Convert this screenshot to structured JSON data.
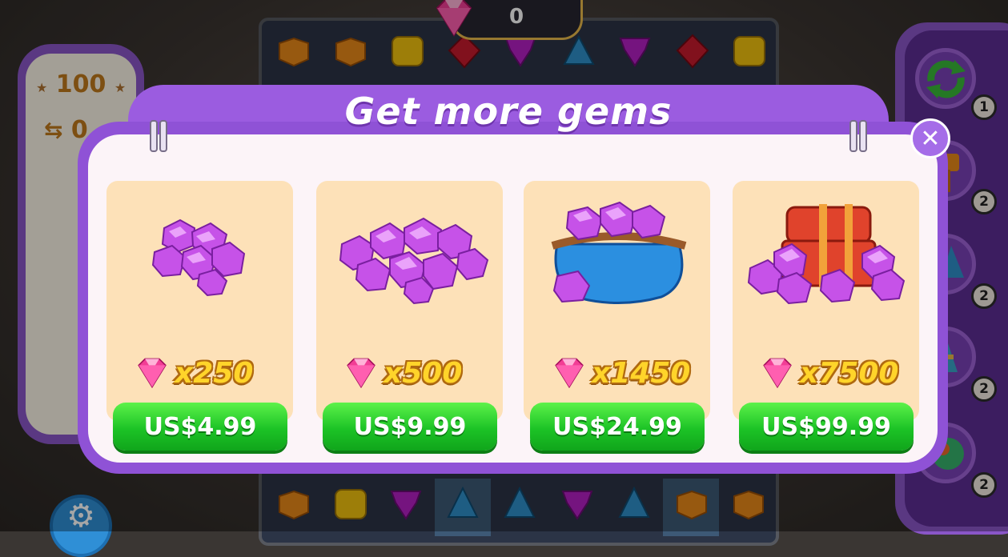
{
  "top_counter": {
    "value": "0",
    "icon": "pink-gem-icon"
  },
  "left_panel": {
    "score": "100",
    "moves": "0"
  },
  "boosters": [
    {
      "name": "shuffle",
      "count": "1"
    },
    {
      "name": "hammer",
      "count": "2"
    },
    {
      "name": "rocket",
      "count": "2"
    },
    {
      "name": "firework",
      "count": "2"
    },
    {
      "name": "rainbow-ball",
      "count": "2"
    }
  ],
  "dialog": {
    "title": "Get more gems",
    "close_icon": "close-icon",
    "offers": [
      {
        "qty": "x250",
        "price": "US$4.99",
        "art": "small-gem-pile"
      },
      {
        "qty": "x500",
        "price": "US$9.99",
        "art": "large-gem-pile"
      },
      {
        "qty": "x1450",
        "price": "US$24.99",
        "art": "gem-bag"
      },
      {
        "qty": "x7500",
        "price": "US$99.99",
        "art": "gem-chest"
      }
    ]
  },
  "colors": {
    "dialog_purple": "#9b5ce0",
    "card_bg": "#fde1b8",
    "buy_green": "#1cc326",
    "qty_yellow": "#ffd42a"
  }
}
